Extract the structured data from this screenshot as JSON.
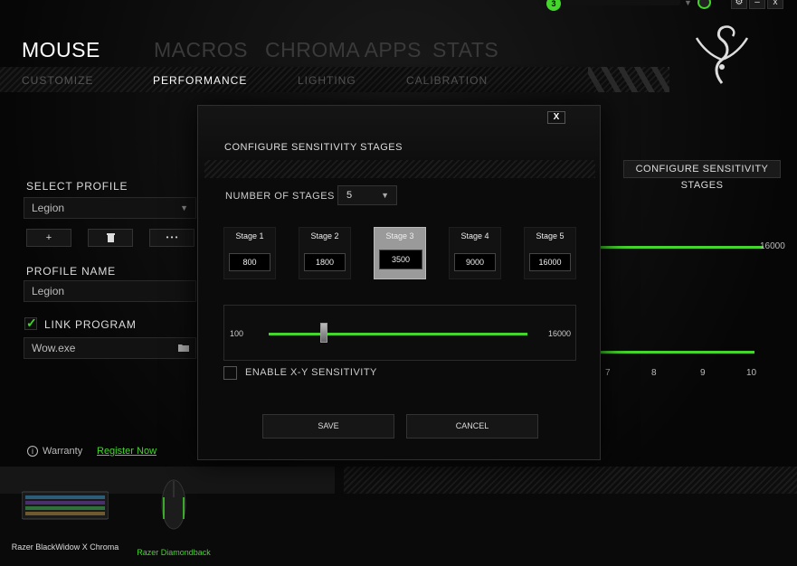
{
  "titlebar": {
    "notification_count": "3",
    "buttons": {
      "settings": "⚙",
      "minimize": "–",
      "close": "x"
    }
  },
  "top_nav": {
    "tabs": [
      {
        "label": "MOUSE",
        "active": true
      },
      {
        "label": "MACROS",
        "active": false
      },
      {
        "label": "CHROMA APPS",
        "active": false
      },
      {
        "label": "STATS",
        "active": false
      }
    ]
  },
  "sub_nav": {
    "tabs": [
      {
        "label": "CUSTOMIZE",
        "active": false
      },
      {
        "label": "PERFORMANCE",
        "active": true
      },
      {
        "label": "LIGHTING",
        "active": false
      },
      {
        "label": "CALIBRATION",
        "active": false
      }
    ]
  },
  "left_panel": {
    "select_profile_label": "SELECT PROFILE",
    "profile_value": "Legion",
    "add_label": "+",
    "delete_icon": "trash-icon",
    "more_label": "• • •",
    "profile_name_label": "PROFILE NAME",
    "profile_name_value": "Legion",
    "link_program_label": "LINK PROGRAM",
    "link_program_checked": true,
    "program_value": "Wow.exe"
  },
  "warranty": {
    "label": "Warranty",
    "link": "Register Now"
  },
  "right_panel": {
    "config_button": "CONFIGURE SENSITIVITY STAGES",
    "top_value": "16000",
    "axis_ticks": [
      "7",
      "8",
      "9",
      "10"
    ]
  },
  "devices": [
    {
      "name": "Razer BlackWidow X Chroma",
      "active": false
    },
    {
      "name": "Razer Diamondback",
      "active": true
    }
  ],
  "modal": {
    "title": "CONFIGURE SENSITIVITY STAGES",
    "close_label": "X",
    "number_of_stages_label": "NUMBER OF STAGES",
    "number_of_stages_value": "5",
    "stages": [
      {
        "label": "Stage 1",
        "value": "800",
        "active": false
      },
      {
        "label": "Stage 2",
        "value": "1800",
        "active": false
      },
      {
        "label": "Stage 3",
        "value": "3500",
        "active": true
      },
      {
        "label": "Stage 4",
        "value": "9000",
        "active": false
      },
      {
        "label": "Stage 5",
        "value": "16000",
        "active": false
      }
    ],
    "slider": {
      "min_label": "100",
      "max_label": "16000",
      "min": 100,
      "max": 16000,
      "value": 3500
    },
    "xy_label": "ENABLE X-Y SENSITIVITY",
    "xy_checked": false,
    "save_label": "SAVE",
    "cancel_label": "CANCEL"
  },
  "colors": {
    "accent": "#44d62c",
    "background": "#060606",
    "inactive_text": "#4a4a4a"
  }
}
